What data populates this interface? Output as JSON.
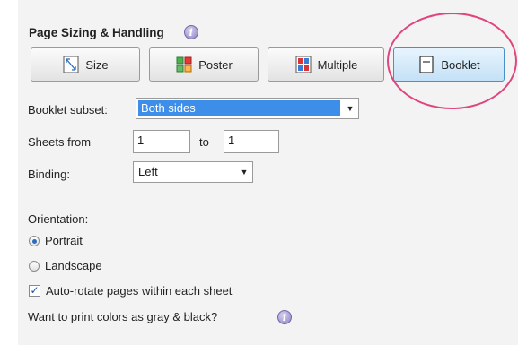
{
  "section": {
    "title": "Page Sizing & Handling"
  },
  "mode_buttons": [
    {
      "label": "Size",
      "active": false,
      "icon": "size-icon"
    },
    {
      "label": "Poster",
      "active": false,
      "icon": "poster-icon"
    },
    {
      "label": "Multiple",
      "active": false,
      "icon": "multiple-icon"
    },
    {
      "label": "Booklet",
      "active": true,
      "icon": "booklet-icon"
    }
  ],
  "booklet_subset": {
    "label": "Booklet subset:",
    "value": "Both sides"
  },
  "sheets": {
    "label": "Sheets from",
    "from": "1",
    "to_label": "to",
    "to": "1"
  },
  "binding": {
    "label": "Binding:",
    "value": "Left"
  },
  "orientation": {
    "label": "Orientation:",
    "options": [
      {
        "label": "Portrait",
        "checked": true
      },
      {
        "label": "Landscape",
        "checked": false
      }
    ]
  },
  "auto_rotate": {
    "label": "Auto-rotate pages within each sheet",
    "checked": true
  },
  "gray_question": "Want to print colors as gray & black?",
  "colors": {
    "highlight": "#e0457e",
    "selection": "#3d8ee8",
    "active_border": "#4a90c8"
  }
}
